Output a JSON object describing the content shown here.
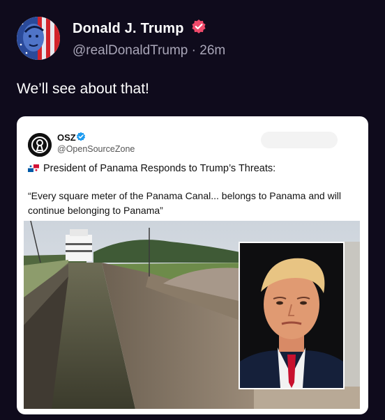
{
  "post": {
    "author_name": "Donald J. Trump",
    "handle": "@realDonaldTrump",
    "separator": "·",
    "time": "26m",
    "text": "We’ll see about that!"
  },
  "quoted": {
    "author_name": "OSZ",
    "handle": "@OpenSourceZone",
    "headline": "President of Panama Responds to Trump’s Threats:",
    "quote": "“Every square meter of the Panama Canal... belongs to Panama and will continue belonging to Panama”"
  },
  "colors": {
    "background": "#0f0b1c",
    "verified_badge": "#f04a6b",
    "quoted_badge": "#1d9bf0",
    "muted_text": "#a9a6b8"
  },
  "icons": {
    "verified": "verified-badge-icon",
    "flag": "panama-flag-icon"
  }
}
